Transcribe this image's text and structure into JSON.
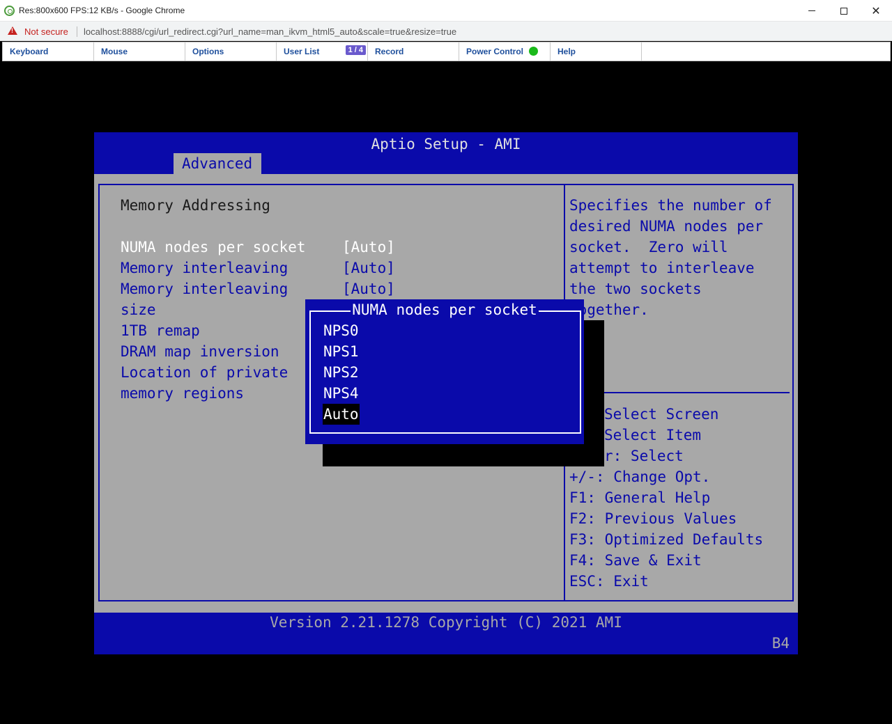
{
  "window": {
    "title": "Res:800x600 FPS:12 KB/s - Google Chrome"
  },
  "address_bar": {
    "security_label": "Not secure",
    "url": "localhost:8888/cgi/url_redirect.cgi?url_name=man_ikvm_html5_auto&scale=true&resize=true"
  },
  "kvm_menu": {
    "keyboard": "Keyboard",
    "mouse": "Mouse",
    "options": "Options",
    "user_list": "User List",
    "user_count": "1 / 4",
    "record": "Record",
    "power_control": "Power Control",
    "power_status_color": "#1ab91a",
    "help": "Help"
  },
  "bios": {
    "title": "Aptio Setup - AMI",
    "tab": "Advanced",
    "section_heading": "Memory Addressing",
    "settings": [
      {
        "label": "NUMA nodes per socket",
        "value": "[Auto]"
      },
      {
        "label": "Memory interleaving",
        "value": "[Auto]"
      },
      {
        "label": "Memory interleaving",
        "value": "[Auto]"
      },
      {
        "label": "size"
      },
      {
        "label": "1TB remap"
      },
      {
        "label": "DRAM map inversion"
      },
      {
        "label": "Location of private"
      },
      {
        "label": "memory regions"
      }
    ],
    "help_text": [
      "Specifies the number of",
      "desired NUMA nodes per",
      "socket.  Zero will",
      "attempt to interleave",
      "the two sockets",
      "together."
    ],
    "key_help": [
      "Select Screen",
      "Select Item",
      "r: Select",
      "+/-: Change Opt.",
      "F1: General Help",
      "F2: Previous Values",
      "F3: Optimized Defaults",
      "F4: Save & Exit",
      "ESC: Exit"
    ],
    "footer": "Version 2.21.1278 Copyright (C) 2021 AMI",
    "footer_code": "B4",
    "colors": {
      "bios_blue": "#0a0aaa",
      "bios_gray": "#a8a8a8"
    }
  },
  "popup": {
    "title": "NUMA nodes per socket",
    "options": [
      "NPS0",
      "NPS1",
      "NPS2",
      "NPS4",
      "Auto"
    ],
    "selected": "Auto"
  }
}
